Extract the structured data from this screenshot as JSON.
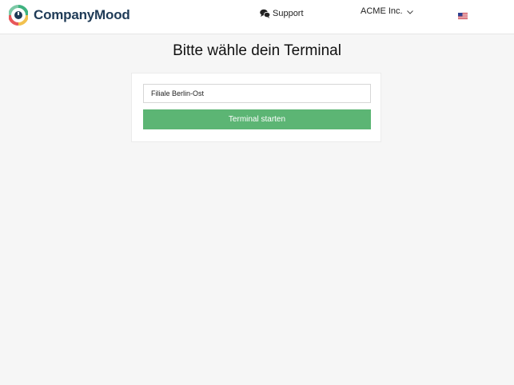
{
  "header": {
    "brand": "CompanyMood",
    "logo_icon": "companymood-logo-icon",
    "support_label": "Support",
    "support_icon": "chat-bubbles-icon",
    "company_label": "ACME Inc.",
    "company_icon": "chevron-down-icon",
    "language_icon": "us-flag-icon"
  },
  "main": {
    "title": "Bitte wähle dein Terminal",
    "terminal_value": "Filiale Berlin-Ost",
    "start_button_label": "Terminal starten"
  },
  "colors": {
    "brand_text": "#1f3b57",
    "button_green": "#5cb574",
    "background": "#f6f6f6"
  }
}
